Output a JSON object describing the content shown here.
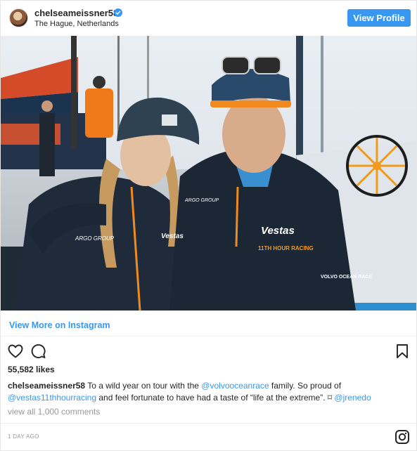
{
  "header": {
    "username": "chelseameissner58",
    "location": "The Hague, Netherlands",
    "view_profile_label": "View Profile",
    "verified_icon": "verified-badge-icon"
  },
  "photo": {
    "icon": "post-photo",
    "visible_text": {
      "brand_left_jacket": "ARGO GROUP",
      "brand_left_chest": "Vestas",
      "brand_right_chest": "Vestas",
      "team_logo": "11TH HOUR RACING",
      "arm_patch": "VOLVO OCEAN RACE",
      "right_shoulder": "ARGO GROUP"
    }
  },
  "view_more_label": "View More on Instagram",
  "actions": {
    "like_icon": "heart-icon",
    "comment_icon": "comment-icon",
    "save_icon": "bookmark-icon"
  },
  "likes": "55,582 likes",
  "caption": {
    "username": "chelseameissner58",
    "part1": " To a wild year on tour with the ",
    "mention1": "@volvooceanrace",
    "part2": " family. So proud of ",
    "mention2": "@vestas11thhourracing",
    "part3": " and feel fortunate to have had a taste of “life at the extreme”. ",
    "emoji": "⌑",
    "mention3": " @jrenedo"
  },
  "comments_label": "view all 1,000 comments",
  "date": "1 DAY AGO",
  "footer_icon": "instagram-icon",
  "colors": {
    "accent": "#3897f0",
    "text": "#262626",
    "muted": "#999999"
  }
}
